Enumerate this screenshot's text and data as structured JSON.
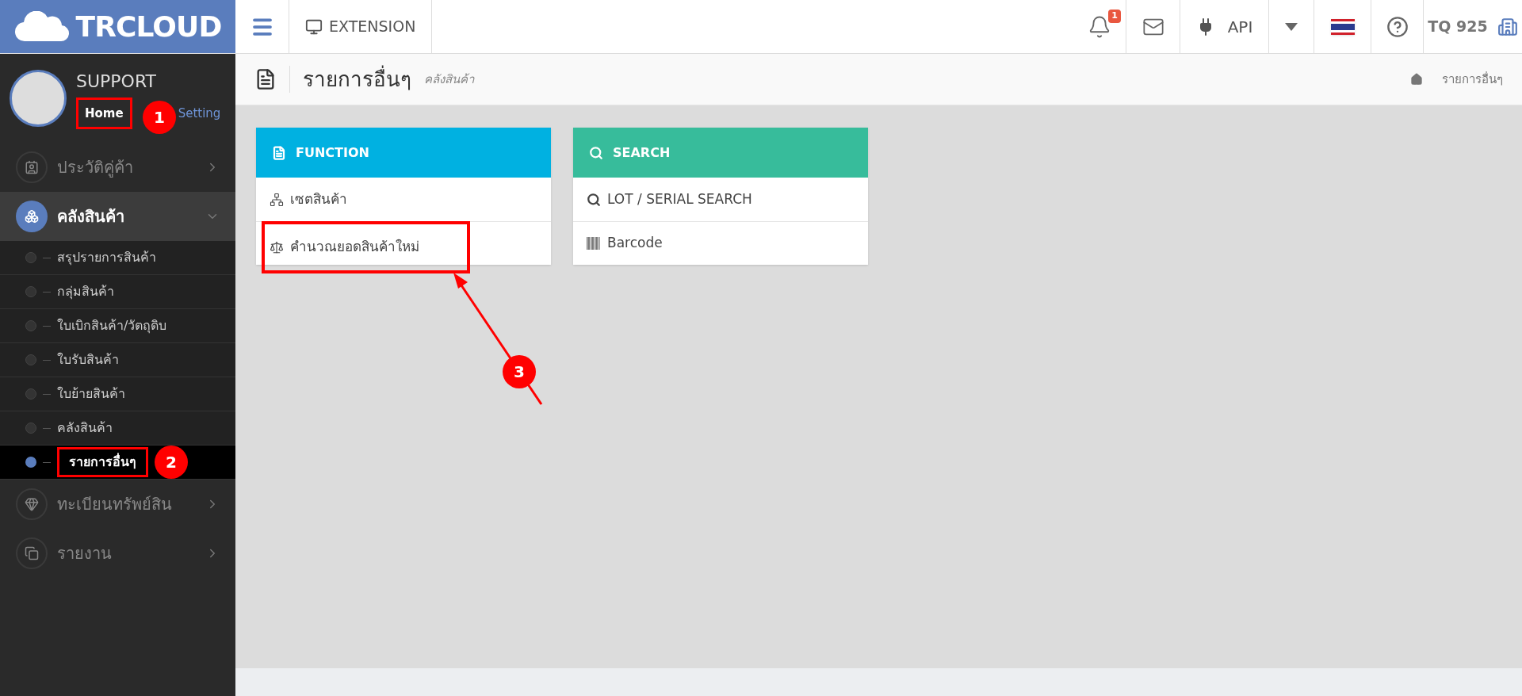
{
  "topbar": {
    "logo": "TRCLOUD",
    "menu_label": "EXTENSION",
    "notification_count": "1",
    "api_label": "API",
    "company": "TQ 925"
  },
  "sidebar": {
    "user": "SUPPORT",
    "links": [
      {
        "label": "Home",
        "selected": true
      },
      {
        "label": "Setting",
        "selected": false
      }
    ],
    "items": [
      {
        "label": "ประวัติคู่ค้า",
        "expanded": false
      },
      {
        "label": "คลังสินค้า",
        "expanded": true,
        "children": [
          {
            "label": "สรุปรายการสินค้า",
            "selected": false
          },
          {
            "label": "กลุ่มสินค้า",
            "selected": false
          },
          {
            "label": "ใบเบิกสินค้า/วัตถุดิบ",
            "selected": false
          },
          {
            "label": "ใบรับสินค้า",
            "selected": false
          },
          {
            "label": "ใบย้ายสินค้า",
            "selected": false
          },
          {
            "label": "คลังสินค้า",
            "selected": false
          },
          {
            "label": "รายการอื่นๆ",
            "selected": true
          }
        ]
      },
      {
        "label": "ทะเบียนทรัพย์สิน",
        "expanded": false
      },
      {
        "label": "รายงาน",
        "expanded": false
      }
    ]
  },
  "page_header": {
    "title": "รายการอื่นๆ",
    "subtitle": "คลังสินค้า",
    "breadcrumb": "รายการอื่นๆ"
  },
  "cards": [
    {
      "title": "FUNCTION",
      "color": "#00b1e1",
      "items": [
        "เซตสินค้า",
        "คำนวณยอดสินค้าใหม่"
      ]
    },
    {
      "title": "SEARCH",
      "color": "#37bc9b",
      "items": [
        "LOT / SERIAL SEARCH",
        "Barcode"
      ]
    }
  ],
  "annotations": [
    {
      "label": "1"
    },
    {
      "label": "2"
    },
    {
      "label": "3"
    }
  ]
}
